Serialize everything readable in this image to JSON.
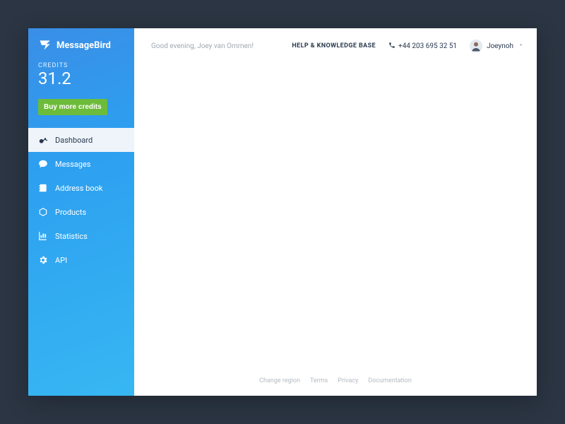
{
  "brand": {
    "name": "MessageBird"
  },
  "credits": {
    "label": "CREDITS",
    "value": "31.2",
    "buy_label": "Buy more credits"
  },
  "nav": {
    "items": [
      {
        "label": "Dashboard",
        "icon": "dashboard-icon",
        "active": true
      },
      {
        "label": "Messages",
        "icon": "messages-icon",
        "active": false
      },
      {
        "label": "Address book",
        "icon": "addressbook-icon",
        "active": false
      },
      {
        "label": "Products",
        "icon": "products-icon",
        "active": false
      },
      {
        "label": "Statistics",
        "icon": "statistics-icon",
        "active": false
      },
      {
        "label": "API",
        "icon": "api-icon",
        "active": false
      }
    ]
  },
  "topbar": {
    "greeting": "Good evening, Joey van Ommen!",
    "help_label": "HELP & KNOWLEDGE BASE",
    "phone": "+44 203 695 32 51",
    "user_name": "Joeynoh"
  },
  "footer": {
    "links": [
      "Change region",
      "Terms",
      "Privacy",
      "Documentation"
    ]
  }
}
